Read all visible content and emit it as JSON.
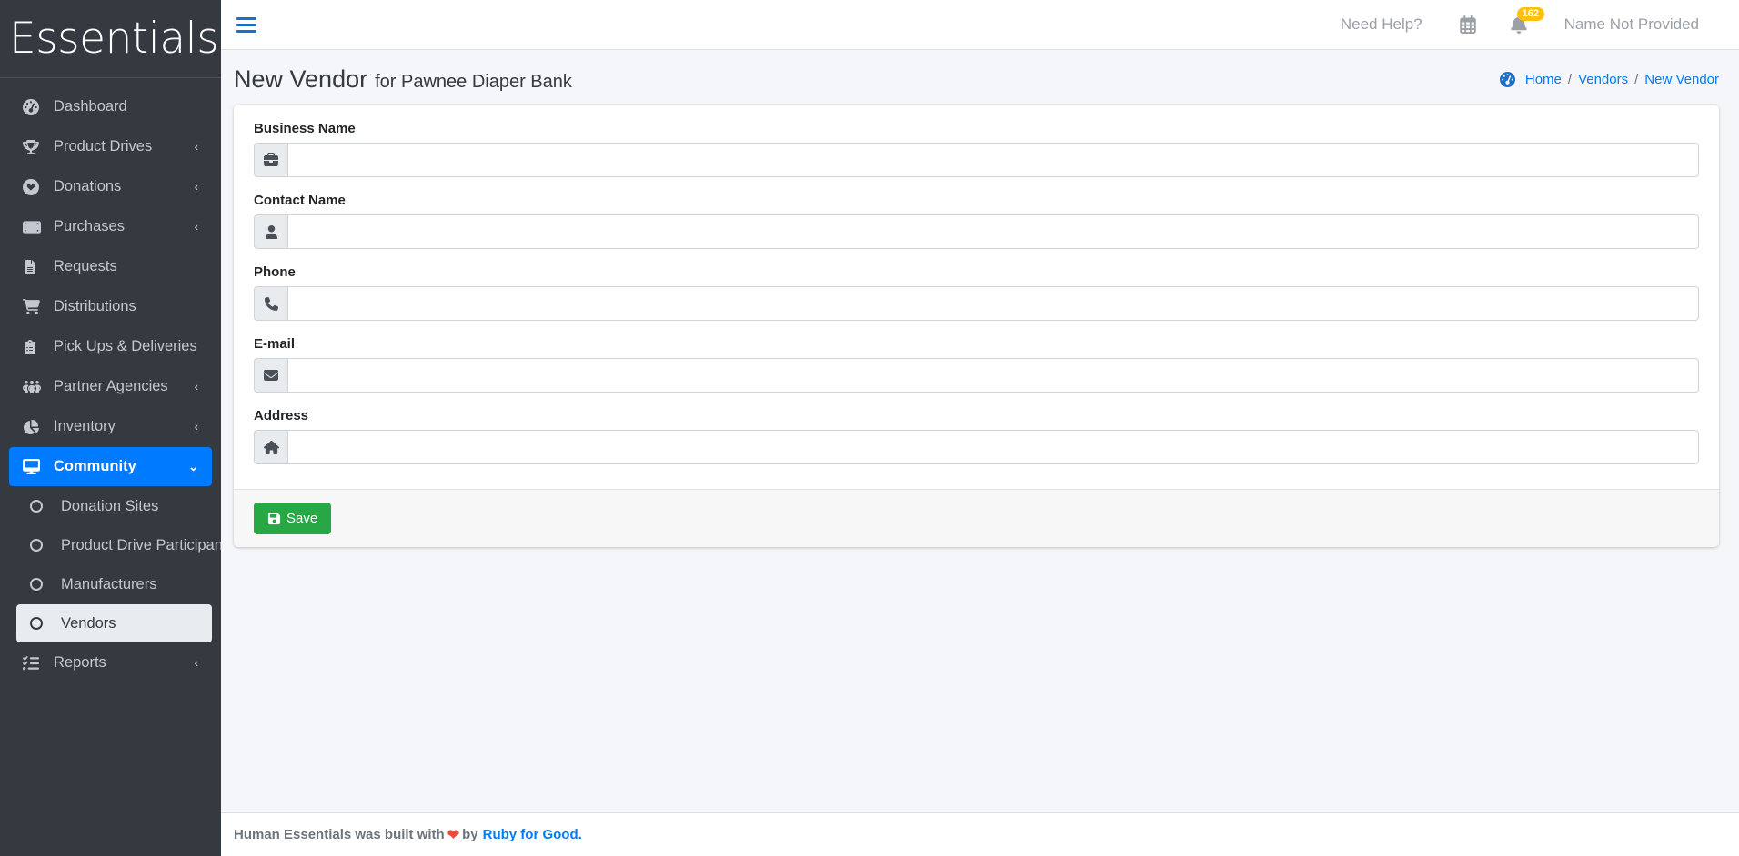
{
  "brand": {
    "name": "Essentials"
  },
  "topbar": {
    "help_label": "Need Help?",
    "calendar_icon": "calendar-icon",
    "bell_icon": "bell-icon",
    "notification_count": "162",
    "user_label": "Name Not Provided",
    "menu_toggle_icon": "hamburger-icon"
  },
  "sidebar": {
    "items": [
      {
        "label": "Dashboard",
        "icon": "tachometer-icon",
        "arrow": "",
        "state": "normal",
        "sub": false
      },
      {
        "label": "Product Drives",
        "icon": "trophy-icon",
        "arrow": "‹",
        "state": "normal",
        "sub": false
      },
      {
        "label": "Donations",
        "icon": "heart-circle-icon",
        "arrow": "‹",
        "state": "normal",
        "sub": false
      },
      {
        "label": "Purchases",
        "icon": "money-bill-icon",
        "arrow": "‹",
        "state": "normal",
        "sub": false
      },
      {
        "label": "Requests",
        "icon": "file-icon",
        "arrow": "",
        "state": "normal",
        "sub": false
      },
      {
        "label": "Distributions",
        "icon": "shopping-cart-icon",
        "arrow": "",
        "state": "normal",
        "sub": false
      },
      {
        "label": "Pick Ups & Deliveries",
        "icon": "calendar-alt-icon",
        "arrow": "",
        "state": "normal",
        "sub": false
      },
      {
        "label": "Partner Agencies",
        "icon": "users-icon",
        "arrow": "‹",
        "state": "normal",
        "sub": false
      },
      {
        "label": "Inventory",
        "icon": "chart-pie-icon",
        "arrow": "‹",
        "state": "normal",
        "sub": false
      },
      {
        "label": "Community",
        "icon": "desktop-icon",
        "arrow": "⌄",
        "state": "active-blue",
        "sub": false
      },
      {
        "label": "Donation Sites",
        "icon": "circle-icon",
        "arrow": "",
        "state": "normal",
        "sub": true
      },
      {
        "label": "Product Drive Participants",
        "icon": "circle-icon",
        "arrow": "",
        "state": "normal",
        "sub": true
      },
      {
        "label": "Manufacturers",
        "icon": "circle-icon",
        "arrow": "",
        "state": "normal",
        "sub": true
      },
      {
        "label": "Vendors",
        "icon": "circle-icon",
        "arrow": "",
        "state": "active-light",
        "sub": true
      },
      {
        "label": "Reports",
        "icon": "list-check-icon",
        "arrow": "‹",
        "state": "normal",
        "sub": false
      }
    ]
  },
  "header": {
    "title_main": "New Vendor",
    "title_sub": "for Pawnee Diaper Bank",
    "breadcrumb": {
      "home_icon": "tachometer-icon",
      "items": [
        "Home",
        "Vendors",
        "New Vendor"
      ],
      "separator": "/"
    }
  },
  "form": {
    "fields": [
      {
        "label": "Business Name",
        "icon": "briefcase-icon",
        "value": "",
        "placeholder": ""
      },
      {
        "label": "Contact Name",
        "icon": "user-icon",
        "value": "",
        "placeholder": ""
      },
      {
        "label": "Phone",
        "icon": "phone-icon",
        "value": "",
        "placeholder": ""
      },
      {
        "label": "E-mail",
        "icon": "envelope-icon",
        "value": "",
        "placeholder": ""
      },
      {
        "label": "Address",
        "icon": "home-icon",
        "value": "",
        "placeholder": ""
      }
    ],
    "save_label": "Save",
    "save_icon": "save-icon"
  },
  "footer": {
    "text_before": "Human Essentials was built with",
    "heart": "❤",
    "text_middle": "by",
    "link": "Ruby for Good.",
    "link_color": "#007bff"
  },
  "colors": {
    "sidebar_bg": "#343a40",
    "accent_blue": "#007bff",
    "save_green": "#28a745",
    "badge_yellow": "#ffc107",
    "page_bg": "#f4f6f9"
  }
}
